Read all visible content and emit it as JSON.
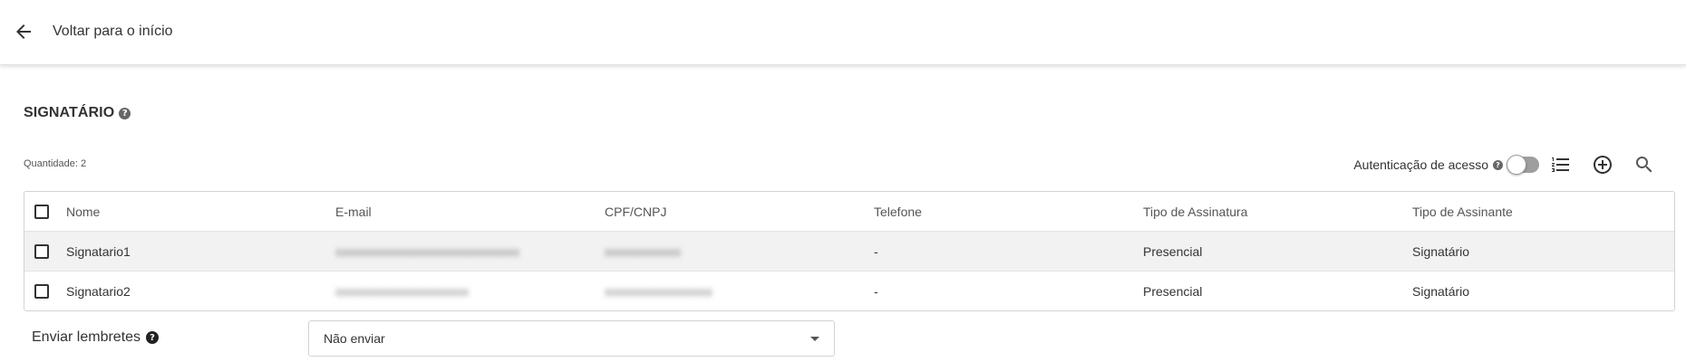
{
  "header": {
    "back_label": "Voltar para o início"
  },
  "section": {
    "title": "SIGNATÁRIO",
    "help_glyph": "?"
  },
  "quantity": {
    "label": "Quantidade:",
    "value": "2"
  },
  "toolbar": {
    "auth_label": "Autenticação de acesso",
    "auth_enabled": false,
    "help_glyph": "?"
  },
  "table": {
    "columns": [
      "Nome",
      "E-mail",
      "CPF/CNPJ",
      "Telefone",
      "Tipo de Assinatura",
      "Tipo de Assinante"
    ],
    "rows": [
      {
        "name": "Signatario1",
        "email": "xxxxxxxxxxxxxxxxxxxxxxxxxxxxx",
        "cpf": "xxxxxxxxxxxx",
        "phone": "-",
        "sign_type": "Presencial",
        "signer_type": "Signatário"
      },
      {
        "name": "Signatario2",
        "email": "xxxxxxxxxxxxxxxxxxxxx",
        "cpf": "xxxxxxxxxxxxxxxxx",
        "phone": "-",
        "sign_type": "Presencial",
        "signer_type": "Signatário"
      }
    ]
  },
  "reminders": {
    "label": "Enviar lembretes",
    "help_glyph": "?",
    "selected": "Não enviar"
  },
  "icons": {
    "back": "arrow-left-icon",
    "list": "list-numbered-icon",
    "add": "add-circle-icon",
    "search": "search-icon",
    "help": "help-circle-icon"
  }
}
